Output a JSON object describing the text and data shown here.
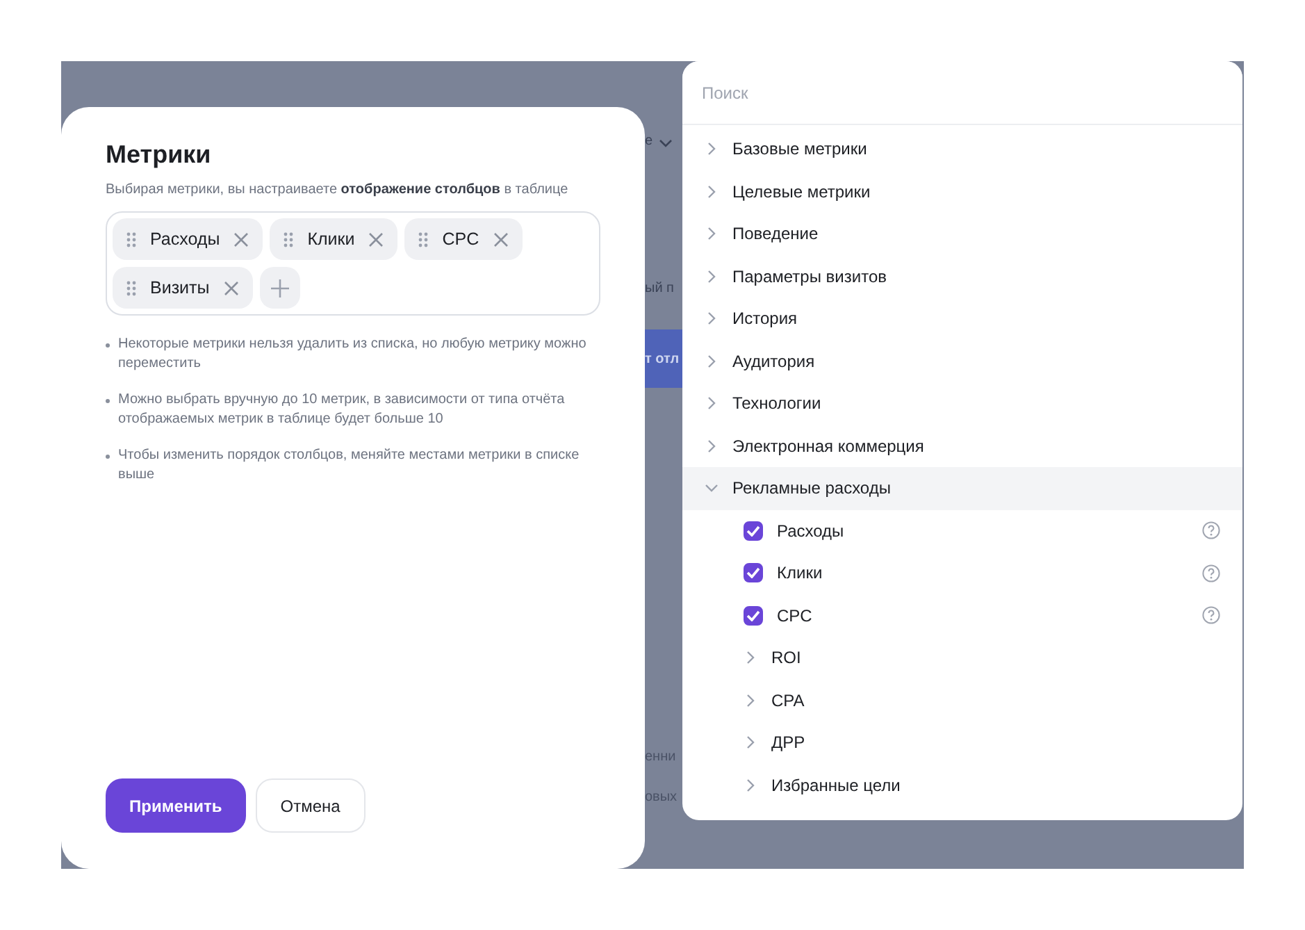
{
  "background_fragments": [
    {
      "text": "е",
      "kind": "dropdown"
    },
    {
      "text": "ый п",
      "kind": "text"
    },
    {
      "text": "т отл",
      "kind": "button"
    },
    {
      "text": "енни",
      "kind": "text"
    },
    {
      "text": "овых",
      "kind": "text"
    }
  ],
  "dialog": {
    "title": "Метрики",
    "subtitle": "Выбирая метрики, вы настраиваете **отображение столбцов** в таблице",
    "chips": [
      {
        "label": "Расходы"
      },
      {
        "label": "Клики"
      },
      {
        "label": "CPC"
      },
      {
        "label": "Визиты"
      }
    ],
    "notes": [
      "Некоторые метрики нельзя удалить из списка, но любую метрику можно переместить",
      "Можно выбрать вручную до 10 метрик, в зависимости от типа отчёта отображаемых метрик в таблице будет больше 10",
      "Чтобы изменить порядок столбцов, меняйте местами метрики в списке выше"
    ],
    "buttons": [
      {
        "label": "Применить",
        "kind": "primary"
      },
      {
        "label": "Отмена",
        "kind": "secondary"
      }
    ]
  },
  "picker": {
    "search": {
      "placeholder": "Поиск"
    },
    "tree": [
      {
        "label": "Базовые метрики",
        "expanded": false
      },
      {
        "label": "Целевые метрики",
        "expanded": false
      },
      {
        "label": "Поведение",
        "expanded": false
      },
      {
        "label": "Параметры визитов",
        "expanded": false
      },
      {
        "label": "История",
        "expanded": false
      },
      {
        "label": "Аудитория",
        "expanded": false
      },
      {
        "label": "Технологии",
        "expanded": false
      },
      {
        "label": "Электронная коммерция",
        "expanded": false
      },
      {
        "label": "Рекламные расходы",
        "expanded": true,
        "children": [
          {
            "kind": "checkbox",
            "label": "Расходы",
            "checked": true
          },
          {
            "kind": "checkbox",
            "label": "Клики",
            "checked": true
          },
          {
            "kind": "checkbox",
            "label": "CPC",
            "checked": true
          },
          {
            "kind": "group",
            "label": "ROI",
            "expanded": false
          },
          {
            "kind": "group",
            "label": "CPA",
            "expanded": false
          },
          {
            "kind": "group",
            "label": "ДРР",
            "expanded": false
          },
          {
            "kind": "group",
            "label": "Избранные цели",
            "expanded": false
          }
        ]
      }
    ]
  }
}
